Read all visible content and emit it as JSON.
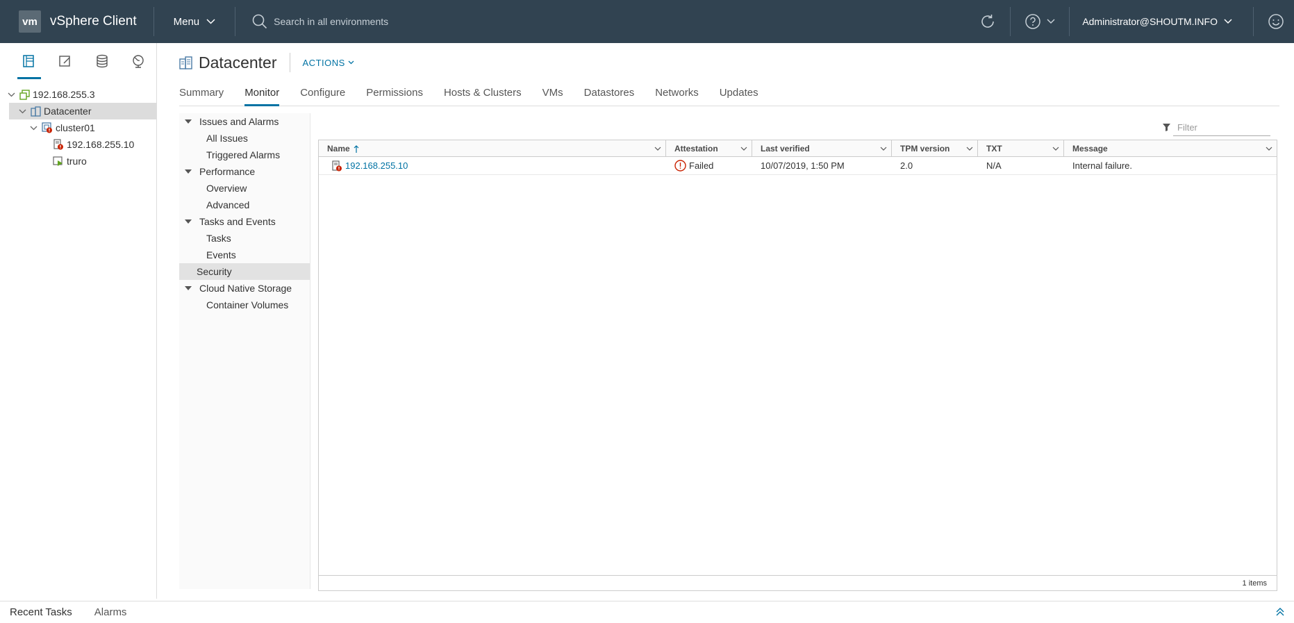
{
  "header": {
    "logo": "vm",
    "app_name": "vSphere Client",
    "menu_label": "Menu",
    "search_placeholder": "Search in all environments",
    "user": "Administrator@SHOUTM.INFO",
    "icons": [
      "search-icon",
      "refresh-icon",
      "help-icon",
      "user-face-icon"
    ],
    "bg_color": "#314351"
  },
  "nav_tabs": [
    "hosts-clusters-icon",
    "vms-templates-icon",
    "storage-icon",
    "networking-icon"
  ],
  "tree": [
    {
      "label": "192.168.255.3",
      "level": 0
    },
    {
      "label": "Datacenter",
      "level": 1
    },
    {
      "label": "cluster01",
      "level": 2
    },
    {
      "label": "192.168.255.10",
      "level": 3
    },
    {
      "label": "truro",
      "level": 3
    }
  ],
  "object": {
    "title": "Datacenter",
    "actions": "ACTIONS"
  },
  "tabs": [
    "Summary",
    "Monitor",
    "Configure",
    "Permissions",
    "Hosts & Clusters",
    "VMs",
    "Datastores",
    "Networks",
    "Updates"
  ],
  "subnav": {
    "groups": [
      {
        "label": "Issues and Alarms",
        "items": [
          "All Issues",
          "Triggered Alarms"
        ]
      },
      {
        "label": "Performance",
        "items": [
          "Overview",
          "Advanced"
        ]
      },
      {
        "label": "Tasks and Events",
        "items": [
          "Tasks",
          "Events"
        ]
      }
    ],
    "security": "Security",
    "cns": {
      "label": "Cloud Native Storage",
      "items": [
        "Container Volumes"
      ]
    }
  },
  "grid": {
    "filter_placeholder": "Filter",
    "columns": [
      "Name",
      "Attestation",
      "Last verified",
      "TPM version",
      "TXT",
      "Message"
    ],
    "rows": [
      {
        "name": "192.168.255.10",
        "attestation": "Failed",
        "last_verified": "10/07/2019, 1:50 PM",
        "tpm": "2.0",
        "txt": "N/A",
        "message": "Internal failure."
      }
    ],
    "footer": "1 items"
  },
  "bottom": {
    "recent_tasks": "Recent Tasks",
    "alarms": "Alarms"
  },
  "colors": {
    "accent": "#0072a3",
    "error": "#c92100",
    "host_green": "#62a420"
  }
}
